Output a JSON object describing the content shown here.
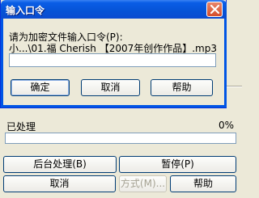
{
  "dialog": {
    "title": "输入口令",
    "prompt": "请为加密文件输入口令(P):",
    "file_name": "小...\\01.福 Cherish 【2007年创作作品】.mp3",
    "password_value": "",
    "ok_label": "确定",
    "cancel_label": "取消",
    "help_label": "帮助"
  },
  "progress_window": {
    "status_label": "已处理",
    "percent_text": "0%",
    "progress": 0,
    "background_label": "后台处理(B)",
    "pause_label": "暂停(P)",
    "cancel_label": "取消",
    "mode_label": "方式(M)...",
    "help_label": "帮助"
  },
  "icons": {
    "close": "close-icon"
  },
  "colors": {
    "title_bar": "#0a5de6",
    "progress_fill": "#3169c6"
  }
}
